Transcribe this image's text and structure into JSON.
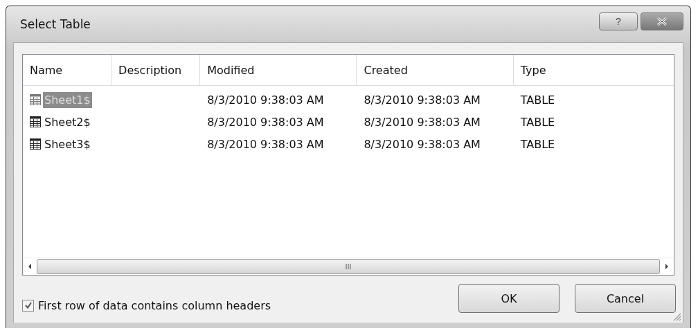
{
  "window": {
    "title": "Select Table",
    "buttons": [
      {
        "kind": "help",
        "label": "?"
      },
      {
        "kind": "close"
      }
    ]
  },
  "table": {
    "columns": [
      "Name",
      "Description",
      "Modified",
      "Created",
      "Type"
    ],
    "rows": [
      {
        "name": "Sheet1$",
        "description": "",
        "modified": "8/3/2010 9:38:03 AM",
        "created": "8/3/2010 9:38:03 AM",
        "type": "TABLE",
        "selected": true
      },
      {
        "name": "Sheet2$",
        "description": "",
        "modified": "8/3/2010 9:38:03 AM",
        "created": "8/3/2010 9:38:03 AM",
        "type": "TABLE",
        "selected": false
      },
      {
        "name": "Sheet3$",
        "description": "",
        "modified": "8/3/2010 9:38:03 AM",
        "created": "8/3/2010 9:38:03 AM",
        "type": "TABLE",
        "selected": false
      }
    ]
  },
  "scrollbar_grip": "III",
  "checkbox": {
    "label": "First row of data contains column headers",
    "checked": true
  },
  "buttons": [
    "OK",
    "Cancel"
  ]
}
